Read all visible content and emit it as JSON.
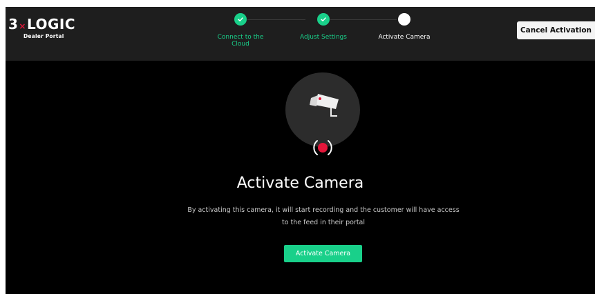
{
  "brand": {
    "logo_left": "3",
    "logo_x": "×",
    "logo_right": "LOGIC",
    "subtitle": "Dealer Portal",
    "accent_color": "#e4163a"
  },
  "steps": [
    {
      "label": "Connect to the Cloud",
      "state": "completed",
      "icon": "check-icon"
    },
    {
      "label": "Adjust Settings",
      "state": "completed",
      "icon": "check-icon"
    },
    {
      "label": "Activate Camera",
      "state": "current",
      "icon": "dot"
    }
  ],
  "header": {
    "cancel_label": "Cancel Activation"
  },
  "main": {
    "camera_icon": "security-camera-icon",
    "record_icon": "record-icon",
    "title": "Activate Camera",
    "description": "By activating this camera, it will start recording and the customer will have access to the feed in their portal",
    "activate_label": "Activate Camera"
  },
  "colors": {
    "primary_green": "#19d08a",
    "record_red": "#e4163a",
    "topbar": "#1e1e1e",
    "background": "#000000"
  }
}
